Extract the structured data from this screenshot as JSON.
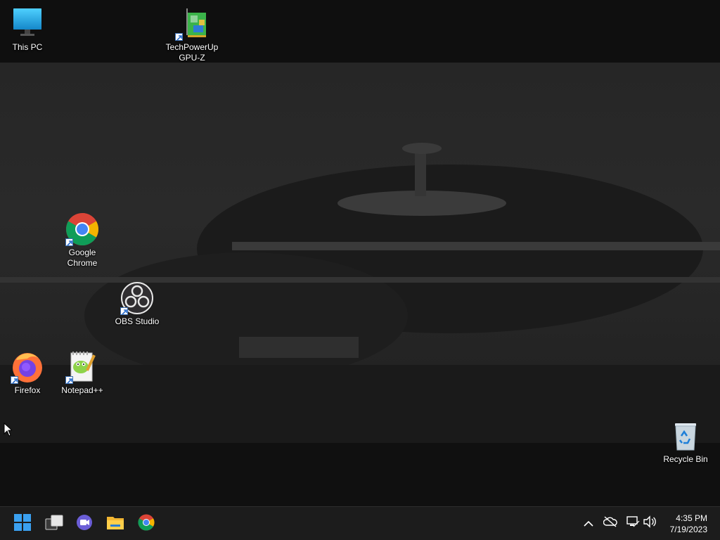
{
  "desktop": {
    "icons": [
      {
        "label": "This PC"
      },
      {
        "label": "TechPowerUp\nGPU-Z"
      },
      {
        "label": "Google\nChrome"
      },
      {
        "label": "OBS Studio"
      },
      {
        "label": "Firefox"
      },
      {
        "label": "Notepad++"
      },
      {
        "label": "Recycle Bin"
      }
    ]
  },
  "taskbar": {
    "pinned": [
      "start-icon",
      "task-view-icon",
      "chat-icon",
      "file-explorer-icon",
      "chrome-icon"
    ],
    "tray": [
      "show-hidden-icons-chevron",
      "onedrive-icon",
      "network-icon",
      "volume-icon"
    ],
    "clock": {
      "time": "4:35 PM",
      "date": "7/19/2023"
    }
  },
  "colors": {
    "taskbar_bg": "#1c1c1c",
    "start_blue": "#3aa0f0",
    "desktop_text": "#ffffff"
  }
}
